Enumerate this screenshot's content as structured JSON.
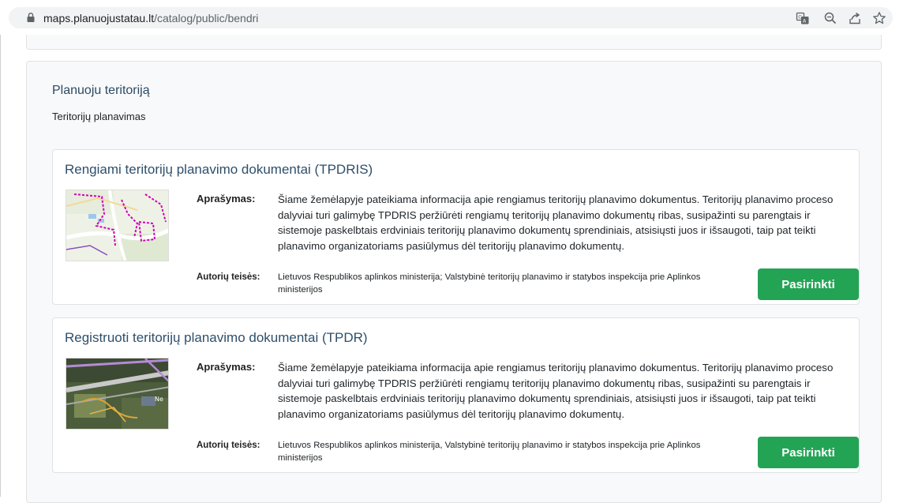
{
  "browser": {
    "url_host": "maps.planuojustatau.lt",
    "url_path": "/catalog/public/bendri",
    "icons": [
      "lock-icon",
      "translate-icon",
      "zoom-icon",
      "share-icon",
      "bookmark-star-icon"
    ]
  },
  "section": {
    "title": "Planuoju teritoriją",
    "subtitle": "Teritorijų planavimas"
  },
  "cards": [
    {
      "title": "Rengiami teritorijų planavimo dokumentai (TPDRIS)",
      "description_label": "Aprašymas:",
      "description": "Šiame žemėlapyje pateikiama informacija apie rengiamus teritorijų planavimo dokumentus. Teritorijų planavimo proceso dalyviai turi galimybę TPDRIS peržiūrėti rengiamų teritorijų planavimo dokumentų ribas, susipažinti su parengtais ir sistemoje paskelbtais erdviniais teritorijų planavimo dokumentų sprendiniais, atsisiųsti juos ir išsaugoti, taip pat teikti planavimo organizatoriams pasiūlymus dėl teritorijų planavimo dokumentų.",
      "copyright_label": "Autorių teisės:",
      "copyright": "Lietuvos Respublikos aplinkos ministerija; Valstybinė teritorijų planavimo ir statybos inspekcija prie Aplinkos ministerijos",
      "button_label": "Pasirinkti"
    },
    {
      "title": "Registruoti teritorijų planavimo dokumentai (TPDR)",
      "description_label": "Aprašymas:",
      "description": "Šiame žemėlapyje pateikiama informacija apie rengiamus teritorijų planavimo dokumentus. Teritorijų planavimo proceso dalyviai turi galimybę TPDRIS peržiūrėti rengiamų teritorijų planavimo dokumentų ribas, susipažinti su parengtais ir sistemoje paskelbtais erdviniais teritorijų planavimo dokumentų sprendiniais, atsisiųsti juos ir išsaugoti, taip pat teikti planavimo organizatoriams pasiūlymus dėl teritorijų planavimo dokumentų.",
      "copyright_label": "Autorių teisės:",
      "copyright": "Lietuvos Respublikos aplinkos ministerija, Valstybinė teritorijų planavimo ir statybos inspekcija prie Aplinkos ministerijos",
      "button_label": "Pasirinkti"
    }
  ],
  "colors": {
    "accent_button": "#23a455",
    "title_text": "#2e4f6b",
    "section_bg": "#f8f9fa"
  }
}
